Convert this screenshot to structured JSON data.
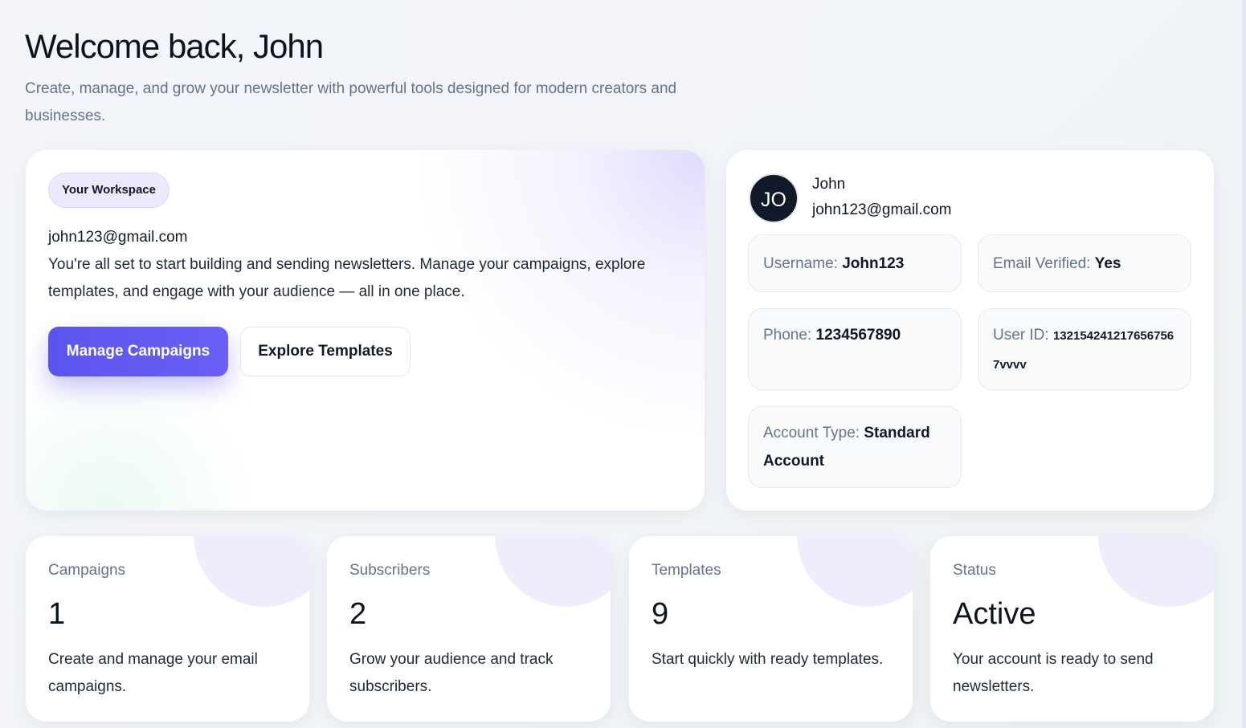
{
  "header": {
    "title": "Welcome back, John",
    "subtitle": "Create, manage, and grow your newsletter with powerful tools designed for modern creators and businesses."
  },
  "workspace": {
    "pill_label": "Your Workspace",
    "email": "john123@gmail.com",
    "description": "You're all set to start building and sending newsletters. Manage your campaigns, explore templates, and engage with your audience — all in one place.",
    "primary_button": "Manage Campaigns",
    "secondary_button": "Explore Templates"
  },
  "profile": {
    "avatar_initials": "JO",
    "name": "John",
    "email": "john123@gmail.com",
    "username_label": "Username:",
    "username_value": "John123",
    "verified_label": "Email Verified:",
    "verified_value": "Yes",
    "phone_label": "Phone:",
    "phone_value": "1234567890",
    "user_id_label": "User ID:",
    "user_id_value": "1321542412176567567vvvv",
    "account_type_label": "Account Type:",
    "account_type_value": "Standard Account"
  },
  "stats": [
    {
      "label": "Campaigns",
      "value": "1",
      "description": "Create and manage your email campaigns."
    },
    {
      "label": "Subscribers",
      "value": "2",
      "description": "Grow your audience and track subscribers."
    },
    {
      "label": "Templates",
      "value": "9",
      "description": "Start quickly with ready templates."
    },
    {
      "label": "Status",
      "value": "Active",
      "description": "Your account is ready to send newsletters."
    }
  ],
  "colors": {
    "accent": "#5b54ee",
    "avatar_bg": "#111827",
    "muted_text": "#64748b",
    "pill_bg": "#ece9fd"
  }
}
